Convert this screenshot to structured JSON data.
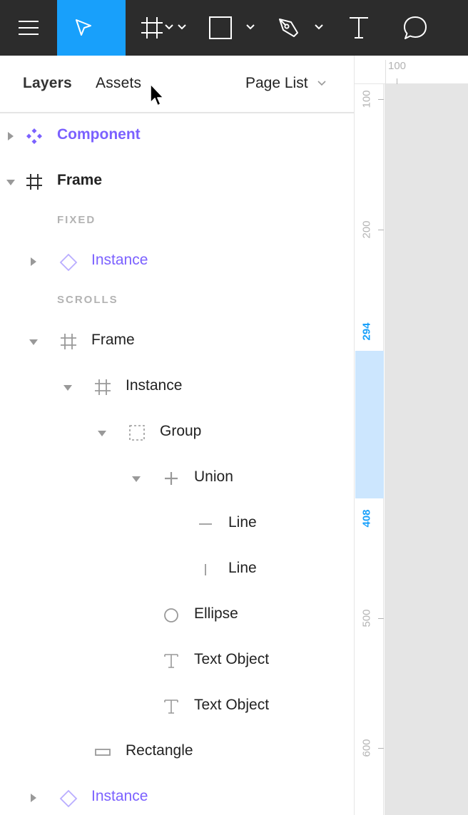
{
  "toolbar": {
    "tools": [
      "menu-icon",
      "move-tool-icon",
      "frame-tool-icon",
      "rectangle-tool-icon",
      "pen-tool-icon",
      "text-tool-icon",
      "comment-tool-icon"
    ],
    "active_tool": "move-tool-icon",
    "active_color": "#18a0fb",
    "background": "#2c2c2c"
  },
  "panel": {
    "tabs": {
      "layers": "Layers",
      "assets": "Assets",
      "page_list": "Page List"
    }
  },
  "layers": {
    "component": "Component",
    "frame": "Frame",
    "fixed_label": "FIXED",
    "instance_fixed": "Instance",
    "scrolls_label": "SCROLLS",
    "frame_inner": "Frame",
    "instance_inner": "Instance",
    "group": "Group",
    "union": "Union",
    "line_1": "Line",
    "line_2": "Line",
    "ellipse": "Ellipse",
    "text_1": "Text Object",
    "text_2": "Text Object",
    "rectangle": "Rectangle",
    "instance_bottom": "Instance"
  },
  "ruler": {
    "horizontal": "100",
    "vertical": [
      "100",
      "200",
      "294",
      "408",
      "500",
      "600"
    ],
    "selection_color": "#18a0fb"
  },
  "colors": {
    "component_purple": "#7b61ff",
    "selection_highlight": "#cce6fe"
  }
}
